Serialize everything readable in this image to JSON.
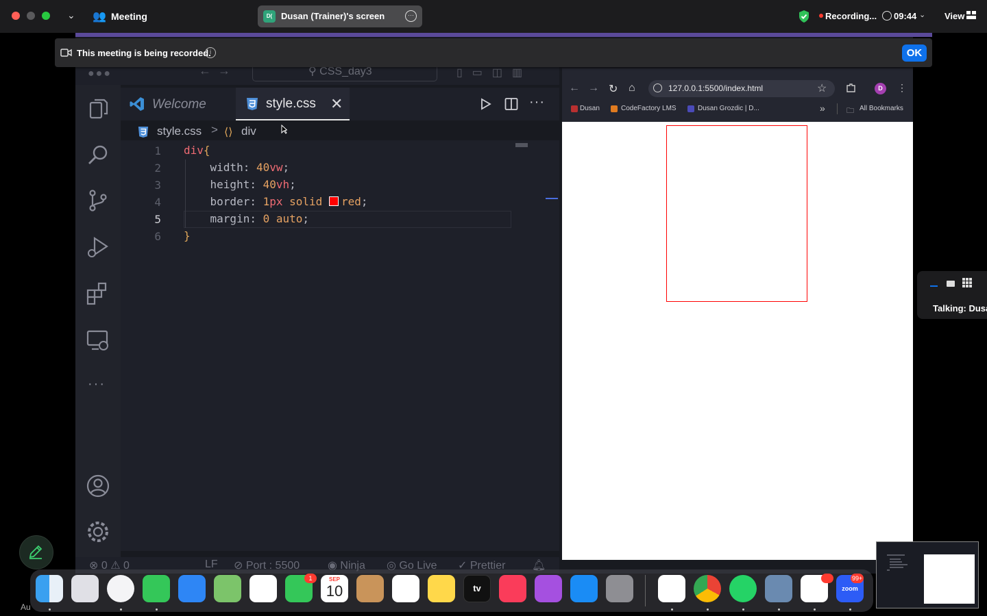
{
  "zoom": {
    "meeting_label": "Meeting",
    "screen_share_badge": "D(",
    "screen_share_label": "Dusan (Trainer)'s screen",
    "recording_label": "Recording...",
    "time": "09:44",
    "view_label": "View",
    "notification_text": "This meeting is being recorded.",
    "notification_info": "i",
    "ok_label": "OK",
    "talking_label": "Talking: Dusa",
    "colors": {
      "accent": "#0e71eb",
      "recording": "#ff3b30",
      "shield": "#30c159"
    }
  },
  "vscode": {
    "search_text": "CSS_day3",
    "tabs": [
      {
        "label": "Welcome",
        "icon": "vscode-logo-icon"
      },
      {
        "label": "style.css",
        "icon": "css3-icon"
      }
    ],
    "breadcrumb": {
      "file": "style.css",
      "separator": ">",
      "symbol": "div"
    },
    "code_lines": [
      {
        "number": "1",
        "parts": [
          [
            "sel",
            "div"
          ],
          [
            "brace",
            "{"
          ]
        ]
      },
      {
        "number": "2",
        "parts": [
          [
            "prop",
            "    width: "
          ],
          [
            "num",
            "40"
          ],
          [
            "unit",
            "vw"
          ],
          [
            "punc",
            ";"
          ]
        ]
      },
      {
        "number": "3",
        "parts": [
          [
            "prop",
            "    height: "
          ],
          [
            "num",
            "40"
          ],
          [
            "unit",
            "vh"
          ],
          [
            "punc",
            ";"
          ]
        ]
      },
      {
        "number": "4",
        "parts": [
          [
            "prop",
            "    border: "
          ],
          [
            "num",
            "1"
          ],
          [
            "unit",
            "px"
          ],
          [
            "kw",
            " solid "
          ],
          [
            "swatch",
            ""
          ],
          [
            "kw",
            "red"
          ],
          [
            "punc",
            ";"
          ]
        ]
      },
      {
        "number": "5",
        "parts": [
          [
            "prop",
            "    margin: "
          ],
          [
            "num",
            "0"
          ],
          [
            "kw",
            " auto"
          ],
          [
            "punc",
            ";"
          ]
        ]
      },
      {
        "number": "6",
        "parts": [
          [
            "brace",
            "}"
          ]
        ]
      }
    ],
    "active_line": "5",
    "status": {
      "problems": "⊗ 0 ⚠ 0",
      "eol": "LF",
      "port": "Port : 5500",
      "ninja": "Ninja",
      "go_live": "Go Live",
      "prettier": "Prettier"
    },
    "colors": {
      "background": "#1e2029",
      "selector": "#ef6b73",
      "number": "#e6a262"
    }
  },
  "browser": {
    "url": "127.0.0.1:5500/index.html",
    "profile_initial": "D",
    "bookmarks": [
      {
        "label": "Dusan",
        "color": "#b83030"
      },
      {
        "label": "CodeFactory LMS",
        "color": "#e07b20"
      },
      {
        "label": "Dusan Grozdic | D...",
        "color": "#4a4ab8"
      }
    ],
    "bookmarks_more": "»",
    "all_bookmarks": "All Bookmarks",
    "page": {
      "box_border_color": "#ff0000",
      "background": "#ffffff"
    }
  },
  "dock": {
    "facetime_badge": "1",
    "calendar_month": "SEP",
    "calendar_day": "10",
    "zoom_badge": "99+",
    "zoom_label": "zoom",
    "appletv_label": "tv",
    "annotate_label": "Au"
  }
}
